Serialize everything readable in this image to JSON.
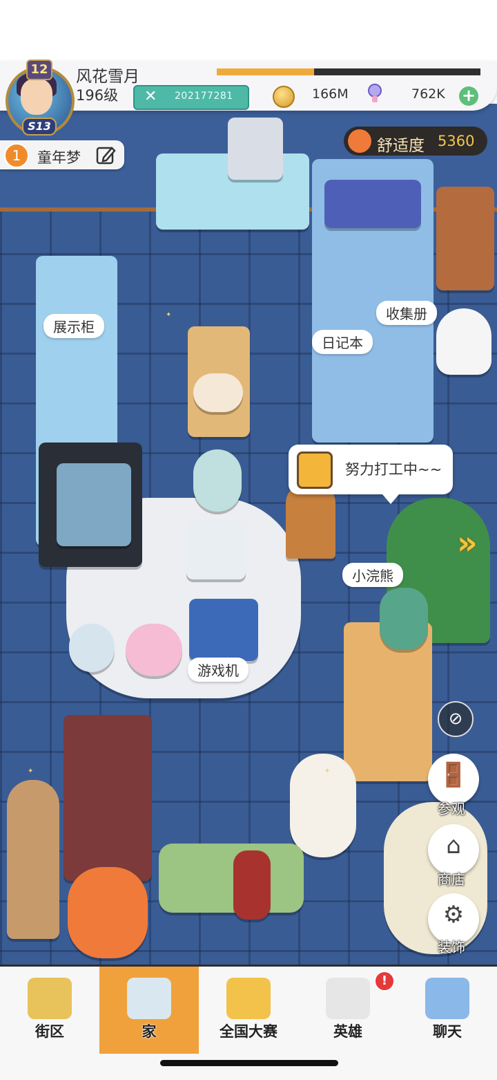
{
  "player": {
    "name": "风花雪月",
    "level": "196级",
    "avatar_level": "12",
    "rank_badge": "S13",
    "id": "202177281",
    "xp_progress": 0.37
  },
  "currency": {
    "coins": "166M",
    "gems": "762K"
  },
  "quest": {
    "number": "1",
    "title": "童年梦"
  },
  "comfort": {
    "label": "舒适度",
    "value": "5360"
  },
  "room_labels": {
    "display_cabinet": "展示柜",
    "collection_book": "收集册",
    "diary": "日记本",
    "game_console": "游戏机",
    "raccoon": "小浣熊"
  },
  "speech": {
    "text": "努力打工中~~"
  },
  "side_actions": {
    "visit": "参观",
    "shop": "商店",
    "decorate": "装饰"
  },
  "nav": {
    "items": [
      {
        "label": "街区"
      },
      {
        "label": "家"
      },
      {
        "label": "全国大赛"
      },
      {
        "label": "英雄"
      },
      {
        "label": "聊天"
      }
    ],
    "active_index": 1,
    "hero_badge": "!"
  },
  "colors": {
    "accent_orange": "#f0a13c",
    "teal_id": "#4fb9a8",
    "floor_blue": "#3a5c94"
  }
}
